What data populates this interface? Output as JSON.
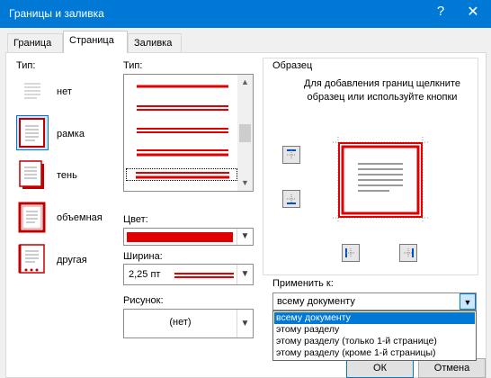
{
  "window": {
    "title": "Границы и заливка",
    "help": "?",
    "close": "✕"
  },
  "tabs": [
    {
      "label": "Граница",
      "active": false
    },
    {
      "label": "Страница",
      "active": true
    },
    {
      "label": "Заливка",
      "active": false
    }
  ],
  "type_section": {
    "label": "Тип:",
    "settings": [
      {
        "label": "нет",
        "selected": false
      },
      {
        "label": "рамка",
        "selected": true
      },
      {
        "label": "тень",
        "selected": false
      },
      {
        "label": "объемная",
        "selected": false
      },
      {
        "label": "другая",
        "selected": false
      }
    ]
  },
  "style_section": {
    "label": "Тип:",
    "line_count": 6
  },
  "color": {
    "label": "Цвет:",
    "value": "#e00000"
  },
  "width": {
    "label": "Ширина:",
    "value": "2,25 пт"
  },
  "art": {
    "label": "Рисунок:",
    "value": "(нет)"
  },
  "preview": {
    "title": "Образец",
    "hint": "Для добавления границ щелкните образец или используйте кнопки"
  },
  "apply": {
    "label": "Применить к:",
    "value": "всему документу",
    "options": [
      {
        "label": "всему документу",
        "highlighted": true
      },
      {
        "label": "этому разделу",
        "highlighted": false
      },
      {
        "label": "этому разделу (только 1-й странице)",
        "highlighted": false
      },
      {
        "label": "этому разделу (кроме 1-й страницы)",
        "highlighted": false
      }
    ]
  },
  "buttons": {
    "ok": "ОК",
    "cancel": "Отмена"
  },
  "colors": {
    "titlebar": "#0079d6",
    "border_red": "#e00000",
    "accent": "#0078d7"
  }
}
